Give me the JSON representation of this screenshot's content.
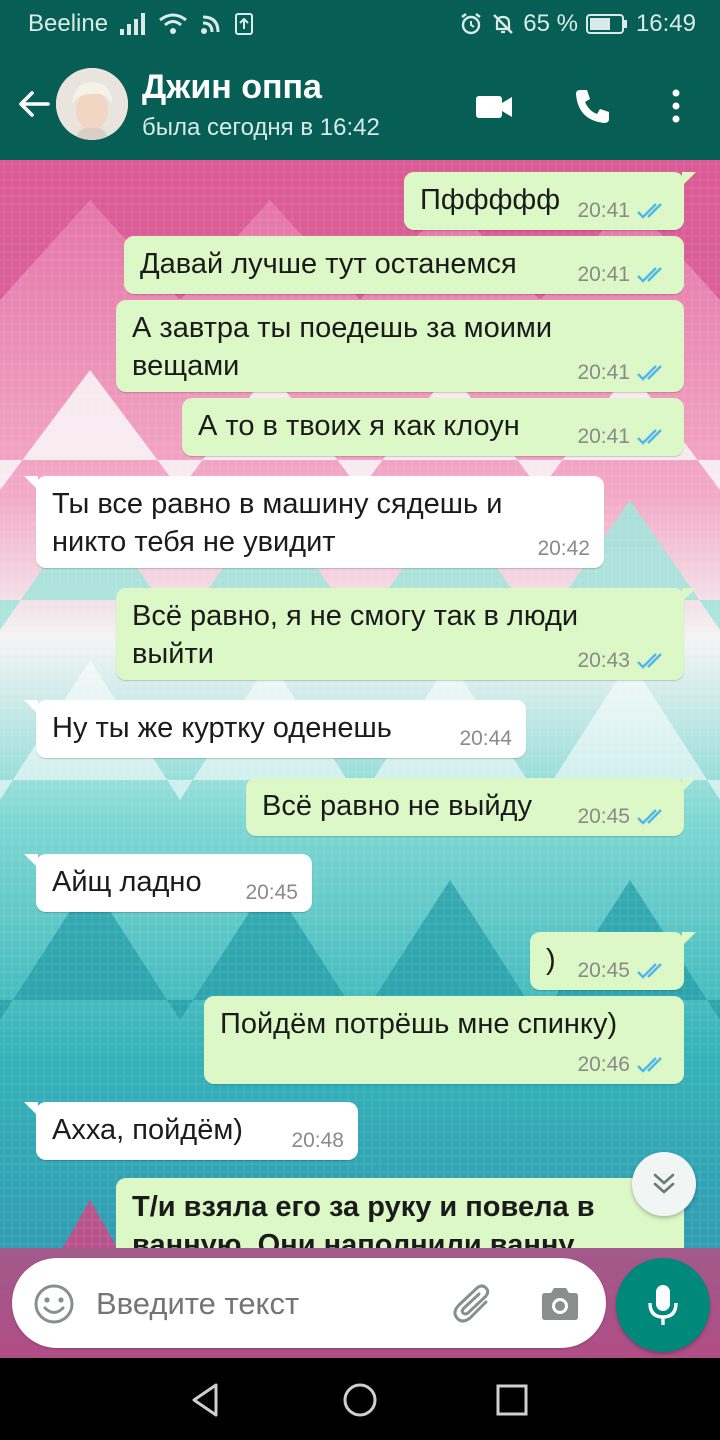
{
  "status_bar": {
    "carrier": "Beeline",
    "battery": "65 %",
    "time": "16:49"
  },
  "header": {
    "contact_name": "Джин оппа",
    "last_seen": "была сегодня в 16:42"
  },
  "messages": [
    {
      "dir": "out",
      "text": "Пффффф",
      "time": "20:41",
      "read": true
    },
    {
      "dir": "out",
      "text": "Давай лучше тут останемся",
      "time": "20:41",
      "read": true
    },
    {
      "dir": "out",
      "text": "А завтра ты поедешь за моими вещами",
      "time": "20:41",
      "read": true
    },
    {
      "dir": "out",
      "text": "А то в твоих я как клоун",
      "time": "20:41",
      "read": true
    },
    {
      "dir": "in",
      "text": "Ты все равно в машину сядешь и никто тебя не увидит",
      "time": "20:42"
    },
    {
      "dir": "out",
      "text": "Всё равно, я не смогу так в люди выйти",
      "time": "20:43",
      "read": true
    },
    {
      "dir": "in",
      "text": "Ну ты же куртку оденешь",
      "time": "20:44"
    },
    {
      "dir": "out",
      "text": "Всё равно не выйду",
      "time": "20:45",
      "read": true
    },
    {
      "dir": "in",
      "text": "Айщ ладно",
      "time": "20:45"
    },
    {
      "dir": "out",
      "text": ")",
      "time": "20:45",
      "read": true
    },
    {
      "dir": "out",
      "text": "Пойдём потрёшь мне спинку)",
      "time": "20:46",
      "read": true
    },
    {
      "dir": "in",
      "text": "Ахха, пойдём)",
      "time": "20:48"
    },
    {
      "dir": "out",
      "text": "Т/и взяла его за руку и повела в ванную. Они наполнили ванну",
      "time": ""
    }
  ],
  "input": {
    "placeholder": "Введите текст"
  },
  "colors": {
    "header": "#075e54",
    "outgoing_bubble": "#dcf8c6",
    "incoming_bubble": "#ffffff",
    "read_ticks": "#4fb6ec",
    "mic_button": "#00897b"
  }
}
